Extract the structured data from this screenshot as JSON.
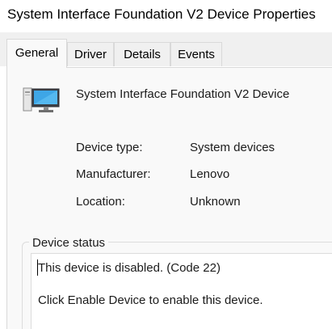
{
  "window": {
    "title": "System Interface Foundation V2 Device Properties"
  },
  "tabs": [
    {
      "label": "General",
      "selected": true
    },
    {
      "label": "Driver",
      "selected": false
    },
    {
      "label": "Details",
      "selected": false
    },
    {
      "label": "Events",
      "selected": false
    }
  ],
  "general": {
    "device_name": "System Interface Foundation V2 Device",
    "device_icon": "computer-monitor-icon",
    "properties": [
      {
        "label": "Device type:",
        "value": "System devices"
      },
      {
        "label": "Manufacturer:",
        "value": "Lenovo"
      },
      {
        "label": "Location:",
        "value": "Unknown"
      }
    ],
    "status": {
      "legend": "Device status",
      "lines": [
        "This device is disabled. (Code 22)",
        "Click Enable Device to enable this device."
      ]
    }
  },
  "colors": {
    "tab_strip_bg": "#f0f0f0",
    "content_bg": "#f9f9f9",
    "border": "#d9d9d9",
    "status_box_bg": "#ffffff"
  }
}
